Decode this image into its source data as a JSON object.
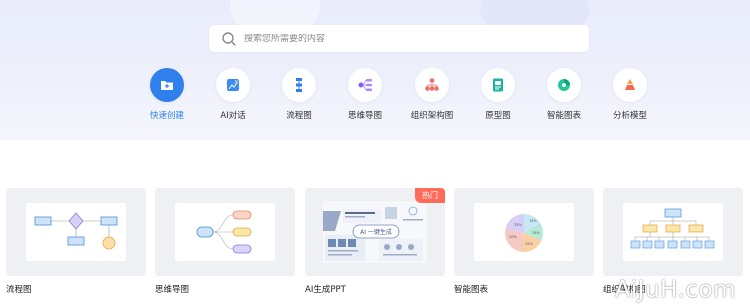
{
  "search": {
    "placeholder": "搜索您所需要的内容"
  },
  "categories": [
    {
      "label": "快速创建",
      "icon": "folder-plus-icon",
      "active": true
    },
    {
      "label": "AI对话",
      "icon": "ai-chat-icon"
    },
    {
      "label": "流程图",
      "icon": "flowchart-icon"
    },
    {
      "label": "思维导图",
      "icon": "mindmap-icon"
    },
    {
      "label": "组织架构图",
      "icon": "org-chart-icon"
    },
    {
      "label": "原型图",
      "icon": "prototype-icon"
    },
    {
      "label": "智能图表",
      "icon": "smart-chart-icon"
    },
    {
      "label": "分析模型",
      "icon": "analysis-model-icon"
    }
  ],
  "cards": [
    {
      "title": "流程图"
    },
    {
      "title": "思维导图"
    },
    {
      "title": "AI生成PPT",
      "badge": "热门",
      "thumb_heading": "AI 一键生成"
    },
    {
      "title": "智能图表",
      "pie_labels": [
        "15%",
        "15%",
        "15%",
        "20%",
        "35%"
      ]
    },
    {
      "title": "组织架构图"
    }
  ],
  "watermark": "AiJuH.com",
  "colors": {
    "accent": "#2f80ed",
    "hot_badge": "#ff6b5a",
    "hero_bg": "#eaedfb"
  }
}
